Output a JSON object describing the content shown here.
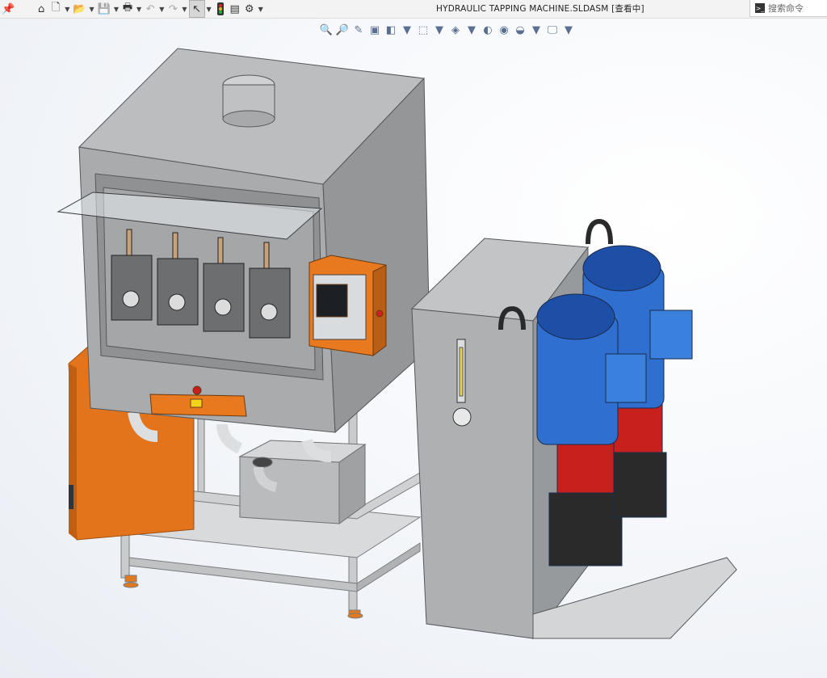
{
  "window": {
    "title": "HYDRAULIC TAPPING MACHINE.SLDASM [查看中]"
  },
  "quick_access": [
    {
      "name": "pin-icon",
      "glyph": "📌"
    },
    {
      "name": "home-icon",
      "glyph": "⌂"
    },
    {
      "name": "new-document-icon",
      "glyph": "🗋"
    },
    {
      "name": "open-icon",
      "glyph": "📂"
    },
    {
      "name": "save-icon",
      "glyph": "💾"
    },
    {
      "name": "print-icon",
      "glyph": "🖶"
    },
    {
      "name": "undo-icon",
      "glyph": "↶"
    },
    {
      "name": "redo-icon",
      "glyph": "↷"
    },
    {
      "name": "select-pointer-icon",
      "glyph": "↖"
    },
    {
      "name": "rebuild-traffic-light-icon",
      "glyph": "●"
    },
    {
      "name": "file-properties-icon",
      "glyph": "▤"
    },
    {
      "name": "options-gear-icon",
      "glyph": "⚙"
    }
  ],
  "search": {
    "placeholder": "搜索命令",
    "prompt_glyph": ">_"
  },
  "heads_up_toolbar": [
    {
      "name": "zoom-to-fit-icon",
      "glyph": "🔍"
    },
    {
      "name": "zoom-to-area-icon",
      "glyph": "🔎"
    },
    {
      "name": "previous-view-icon",
      "glyph": "✎"
    },
    {
      "name": "section-view-icon",
      "glyph": "▣"
    },
    {
      "name": "dynamic-annotation-icon",
      "glyph": "◧"
    },
    {
      "name": "view-orientation-icon",
      "glyph": "⬚"
    },
    {
      "name": "display-style-icon",
      "glyph": "◈"
    },
    {
      "name": "hide-show-items-icon",
      "glyph": "◐"
    },
    {
      "name": "edit-appearance-icon",
      "glyph": "◉"
    },
    {
      "name": "apply-scene-icon",
      "glyph": "◒"
    },
    {
      "name": "view-settings-icon",
      "glyph": "🖵"
    }
  ],
  "colors": {
    "sheet_metal": "#a7a9ab",
    "orange": "#e87a1e",
    "motor_blue": "#2f6fcf",
    "pump_red": "#c8201c",
    "dark": "#2b2b2b"
  }
}
